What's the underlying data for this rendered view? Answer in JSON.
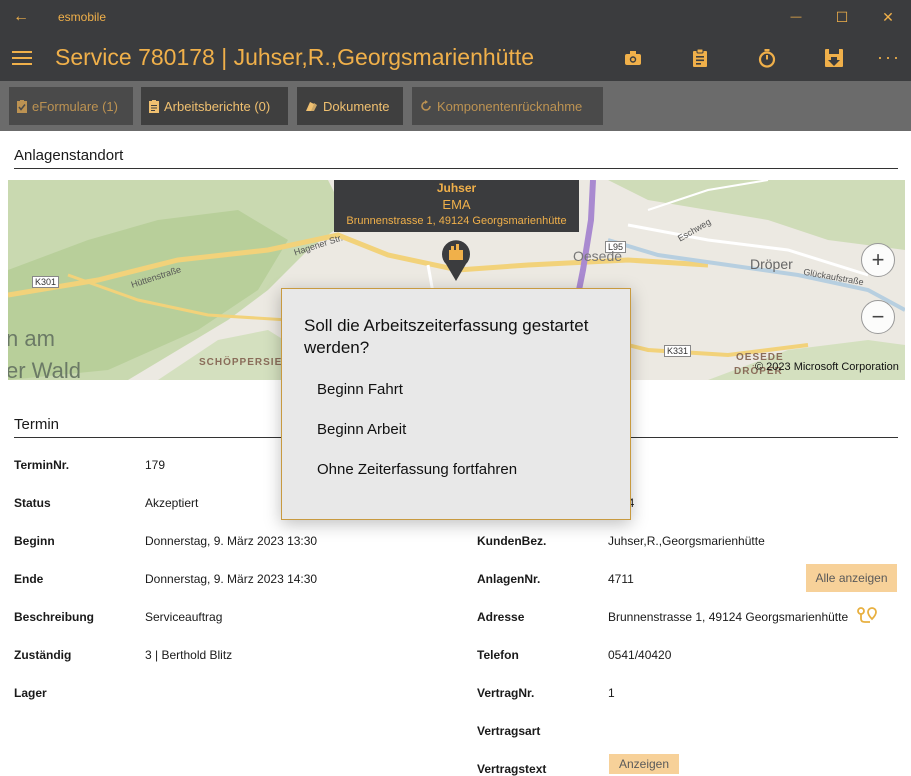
{
  "window": {
    "app_name": "esmobile",
    "back_glyph": "←",
    "minimize_glyph": "—",
    "maximize_glyph": "☐",
    "close_glyph": "✕"
  },
  "header": {
    "title": "Service 780178  |  Juhser,R.,Georgsmarienhütte",
    "more_glyph": "···",
    "icons": [
      "camera-icon",
      "clipboard-icon",
      "stopwatch-icon",
      "save-download-icon"
    ]
  },
  "tabs": [
    {
      "label": "eFormulare (1)",
      "icon": "form-icon"
    },
    {
      "label": "Arbeitsberichte (0)",
      "icon": "clipboard-icon"
    },
    {
      "label": "Dokumente",
      "icon": "documents-icon"
    },
    {
      "label": "Komponentenrücknahme",
      "icon": "refresh-icon"
    }
  ],
  "location": {
    "heading": "Anlagenstandort",
    "pin": {
      "name": "Juhser",
      "type": "EMA",
      "address": "Brunnenstrasse 1, 49124 Georgsmarienhütte"
    },
    "map_labels": [
      "Hüttenstraße",
      "Hagener Str.",
      "K301",
      "L95",
      "Oesede",
      "Dröper",
      "Eschweg",
      "Glückaufstraße",
      "K331",
      "SCHÖPPERSIED",
      "OESEDE",
      "DRÖPER",
      "n am",
      "er Wald"
    ],
    "zoom_in": "+",
    "zoom_out": "−",
    "copyright": "© 2023 Microsoft Corporation"
  },
  "termin": {
    "heading": "Termin",
    "left": [
      {
        "label": "TerminNr.",
        "value": "179"
      },
      {
        "label": "Status",
        "value": "Akzeptiert"
      },
      {
        "label": "Beginn",
        "value": "Donnerstag, 9. März 2023 13:30"
      },
      {
        "label": "Ende",
        "value": "Donnerstag, 9. März 2023 14:30"
      },
      {
        "label": "Beschreibung",
        "value": "Serviceauftrag"
      },
      {
        "label": "Zuständig",
        "value": "3  |  Berthold Blitz"
      },
      {
        "label": "Lager",
        "value": ""
      }
    ],
    "right_partial": "04",
    "right": [
      {
        "label": "KundenBez.",
        "value": "Juhser,R.,Georgsmarienhütte"
      },
      {
        "label": "AnlagenNr.",
        "value": "4711"
      },
      {
        "label": "Adresse",
        "value": "Brunnenstrasse 1, 49124 Georgsmarienhütte"
      },
      {
        "label": "Telefon",
        "value": "0541/40420"
      },
      {
        "label": "VertragNr.",
        "value": "1"
      },
      {
        "label": "Vertragsart",
        "value": ""
      },
      {
        "label": "Vertragstext",
        "value": ""
      }
    ],
    "show_all_button": "Alle anzeigen",
    "show_button": "Anzeigen"
  },
  "dialog": {
    "question": "Soll die Arbeitszeiterfassung gestartet werden?",
    "options": [
      "Beginn Fahrt",
      "Beginn Arbeit",
      "Ohne Zeiterfassung fortfahren"
    ]
  },
  "colors": {
    "accent": "#f0b04a",
    "bar": "#3b3c3e",
    "tabbar": "#6b6b6b",
    "button": "#f7d199"
  }
}
